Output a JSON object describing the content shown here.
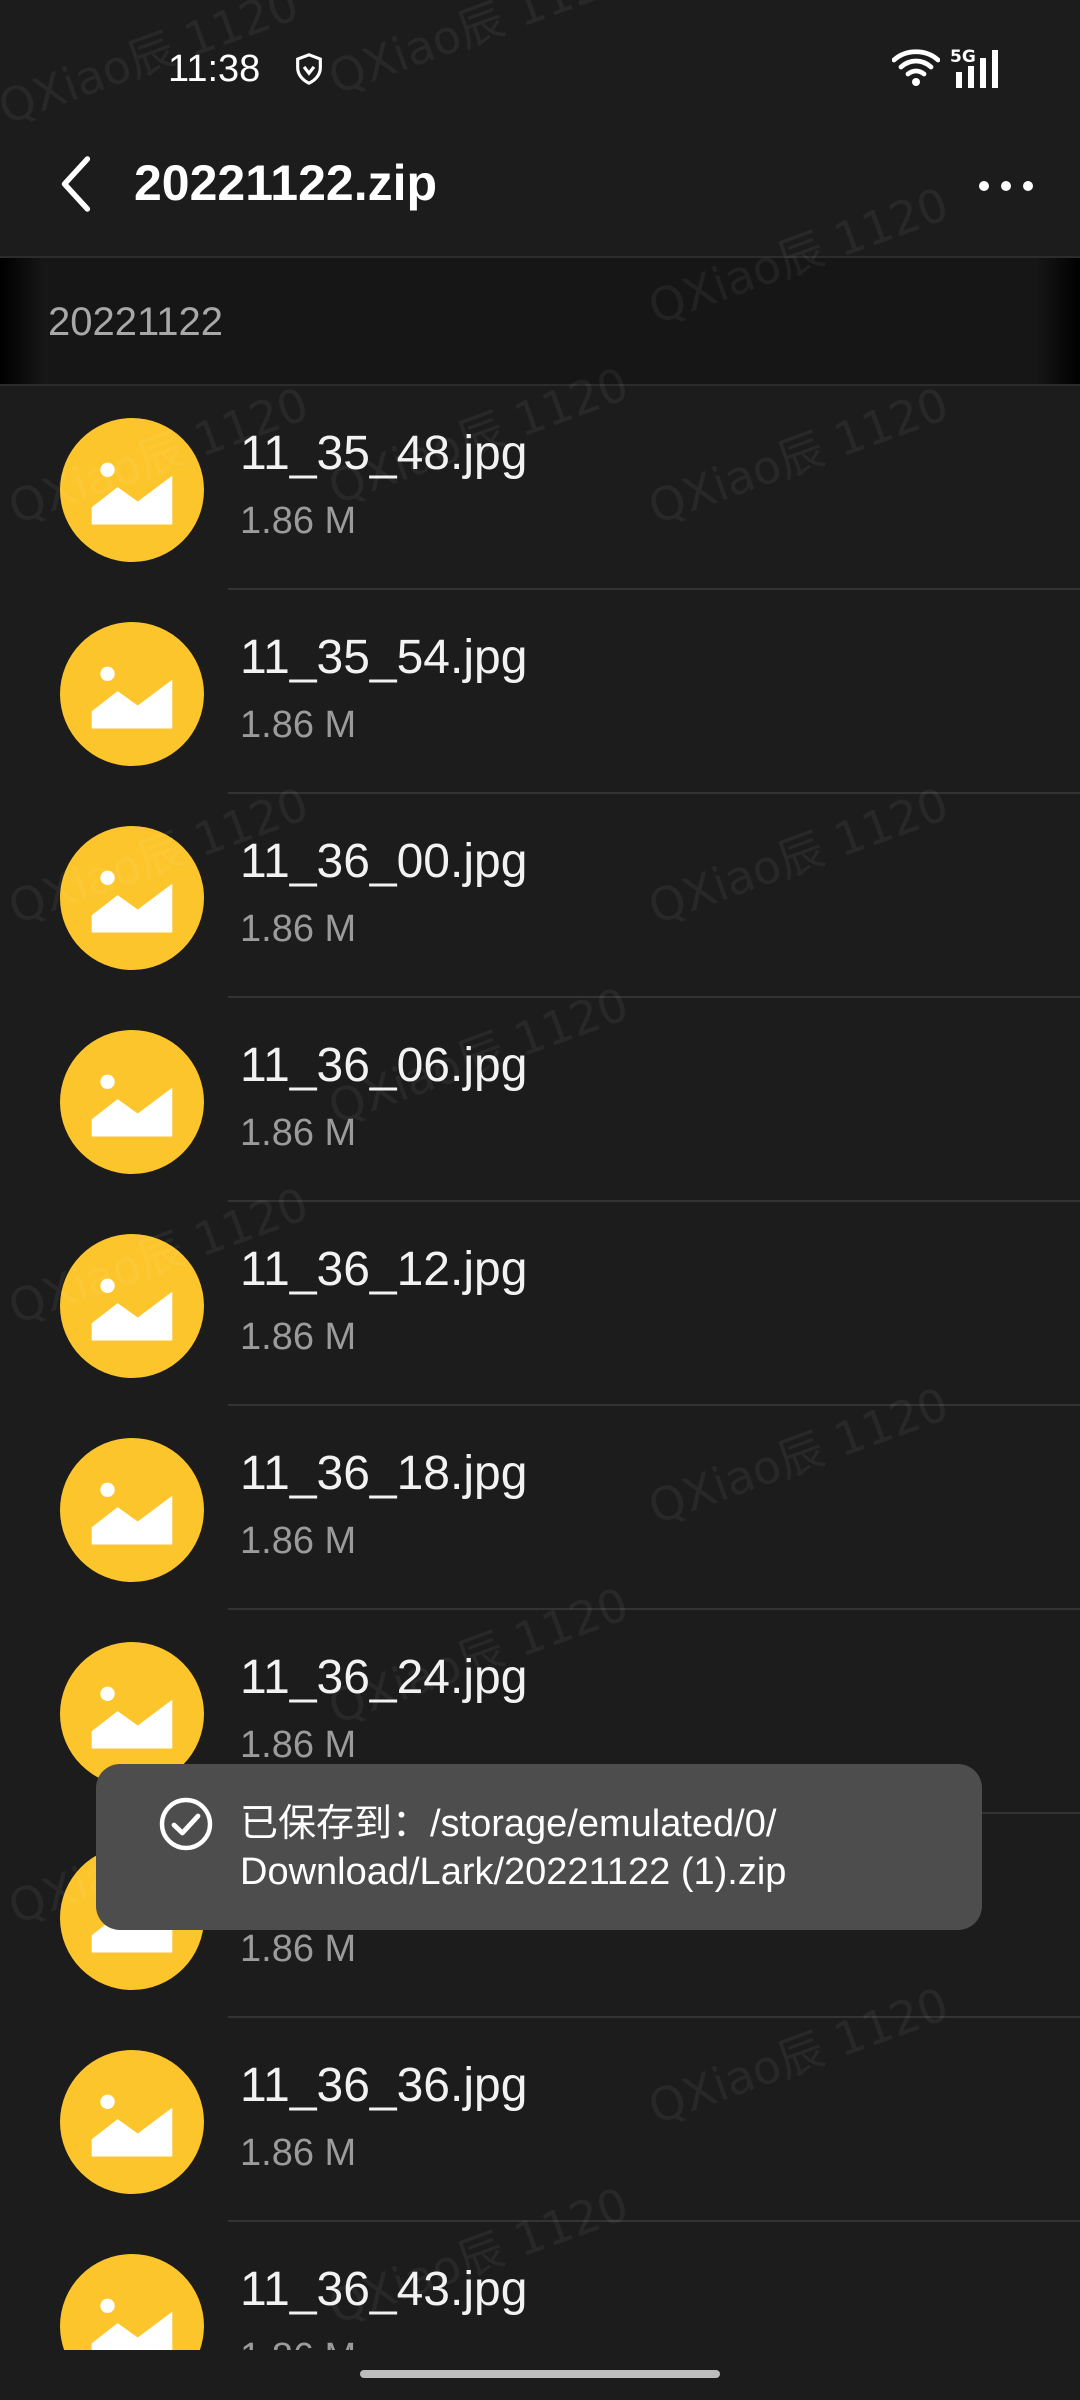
{
  "status_bar": {
    "time": "11:38",
    "network_label": "5G"
  },
  "header": {
    "title": "20221122.zip"
  },
  "breadcrumb": {
    "path": "20221122"
  },
  "files": [
    {
      "name": "11_35_48.jpg",
      "size": "1.86 M"
    },
    {
      "name": "11_35_54.jpg",
      "size": "1.86 M"
    },
    {
      "name": "11_36_00.jpg",
      "size": "1.86 M"
    },
    {
      "name": "11_36_06.jpg",
      "size": "1.86 M"
    },
    {
      "name": "11_36_12.jpg",
      "size": "1.86 M"
    },
    {
      "name": "11_36_18.jpg",
      "size": "1.86 M"
    },
    {
      "name": "11_36_24.jpg",
      "size": "1.86 M"
    },
    {
      "name": "",
      "size": "1.86 M"
    },
    {
      "name": "11_36_36.jpg",
      "size": "1.86 M"
    },
    {
      "name": "11_36_43.jpg",
      "size": "1.86 M"
    }
  ],
  "toast": {
    "line1": "已保存到：/storage/emulated/0/",
    "line2": "Download/Lark/20221122 (1).zip"
  },
  "watermark": {
    "text": "QXiao辰 1120"
  },
  "colors": {
    "background": "#1c1c1c",
    "icon_accent": "#fcc52b",
    "toast_bg": "#4d4d4d"
  },
  "icons": {
    "file_type": "image-file-icon",
    "back": "back-arrow-icon",
    "more": "more-options-icon",
    "toast": "check-circle-icon"
  }
}
